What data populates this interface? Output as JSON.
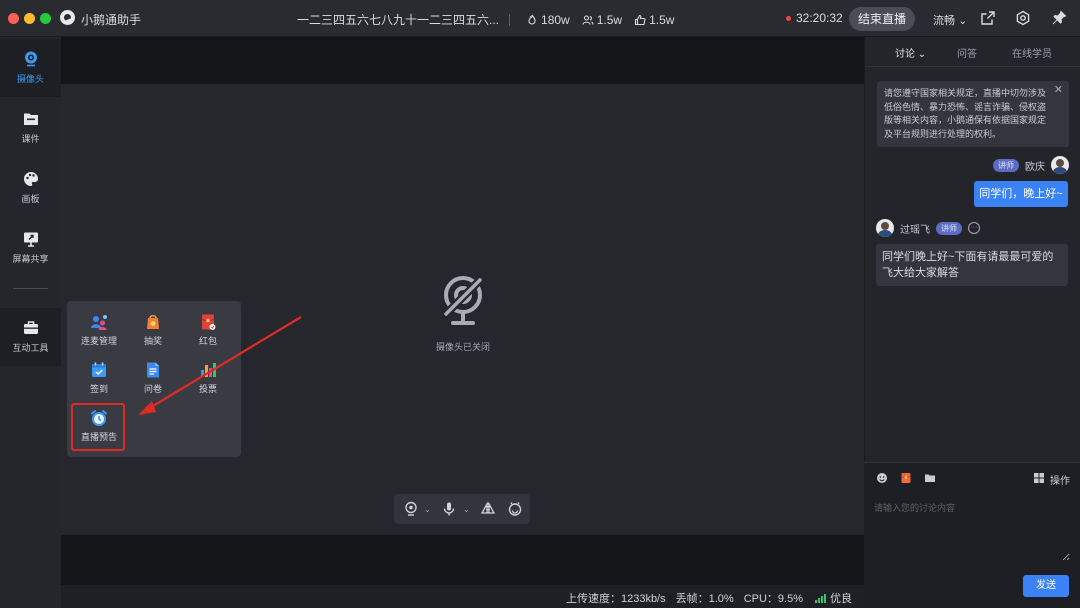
{
  "titlebar": {
    "app_name": "小鹅通助手",
    "course_title": "一二三四五六七八九十一二三四五六...",
    "stats": {
      "popularity": "180w",
      "viewers": "1.5w",
      "likes": "1.5w"
    },
    "live_time": "32:20:32",
    "end_live_label": "结束直播",
    "quality_label": "流畅",
    "quality_caret": "⌄"
  },
  "sidebar": {
    "items": [
      {
        "label": "摄像头",
        "icon": "camera-icon",
        "active": true
      },
      {
        "label": "课件",
        "icon": "folder-icon"
      },
      {
        "label": "画板",
        "icon": "palette-icon"
      },
      {
        "label": "屏幕共享",
        "icon": "screen-share-icon"
      },
      {
        "label": "互动工具",
        "icon": "toolbox-icon"
      }
    ]
  },
  "stage": {
    "camera_off_label": "摄像头已关闭",
    "controls": {
      "caret": "⌄"
    }
  },
  "tools_popup": {
    "items": [
      {
        "label": "连麦管理",
        "icon": "mic-link-icon"
      },
      {
        "label": "抽奖",
        "icon": "lottery-icon"
      },
      {
        "label": "红包",
        "icon": "red-packet-icon"
      },
      {
        "label": "签到",
        "icon": "check-in-icon"
      },
      {
        "label": "问卷",
        "icon": "questionnaire-icon"
      },
      {
        "label": "投票",
        "icon": "vote-icon"
      },
      {
        "label": "直播预告",
        "icon": "alarm-clock-icon"
      }
    ]
  },
  "status_bar": {
    "upload_speed": "上传速度：1233kb/s",
    "frame_loss": "丢帧：1.0%",
    "cpu": "CPU：9.5%",
    "network": "优良"
  },
  "right_panel": {
    "tabs": [
      {
        "label": "讨论",
        "active": true
      },
      {
        "label": "问答"
      },
      {
        "label": "在线学员"
      }
    ],
    "tab_caret": "⌄",
    "notice": "请您遵守国家相关规定，直播中切勿涉及低俗色情、暴力恐怖、谣言诈骗、侵权盗版等相关内容，小鹅通保有依据国家规定及平台规则进行处理的权利。",
    "notice_close": "✕",
    "messages": [
      {
        "name": "欧庆",
        "badge": "讲师",
        "text": "同学们，晚上好~",
        "mine": true
      },
      {
        "name": "过瑶飞",
        "badge": "讲师",
        "text": "同学们晚上好~下面有请最最可爱的飞大给大家解答",
        "mine": false
      }
    ],
    "more_glyph": "···",
    "input_placeholder": "请输入您的讨论内容",
    "operate_label": "操作",
    "send_label": "发送"
  },
  "colors": {
    "accent": "#3b82f6",
    "live_dot": "#f04545",
    "highlight": "#e02b25"
  }
}
